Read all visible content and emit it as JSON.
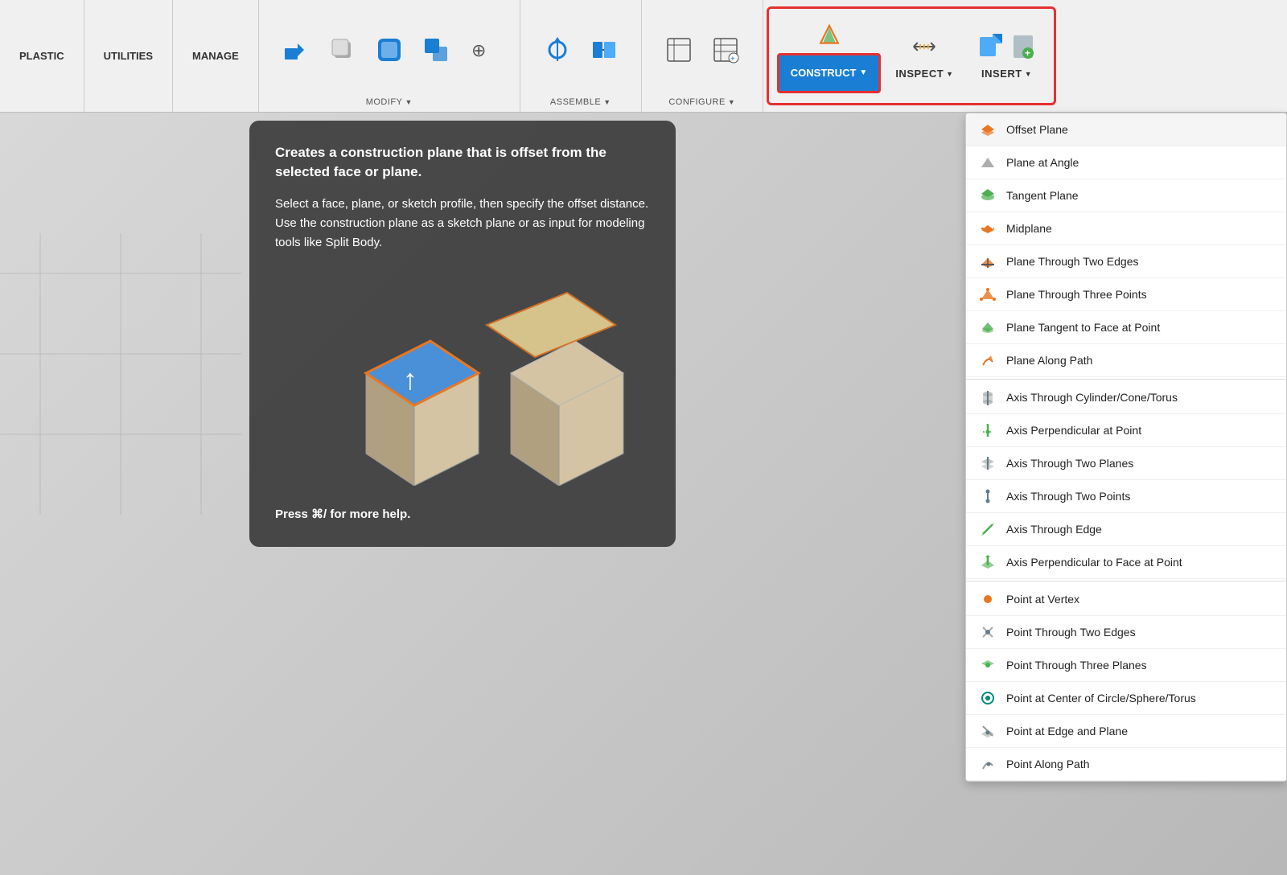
{
  "toolbar": {
    "sections": [
      {
        "label": "PLASTIC"
      },
      {
        "label": "UTILITIES"
      },
      {
        "label": "MANAGE"
      }
    ],
    "modify_label": "MODIFY",
    "assemble_label": "ASSEMBLE",
    "configure_label": "CONFIGURE",
    "construct_label": "CONSTRUCT",
    "inspect_label": "INSPECT",
    "insert_label": "INSERT"
  },
  "tooltip": {
    "title": "Creates a construction plane that is offset from the selected face or plane.",
    "body": "Select a face, plane, or sketch profile, then specify the offset distance. Use the construction plane as a sketch plane or as input for modeling tools like Split Body.",
    "footer": "Press ⌘/ for more help."
  },
  "menu": {
    "items": [
      {
        "label": "Offset Plane",
        "icon": "plane-orange",
        "active": true
      },
      {
        "label": "Plane at Angle",
        "icon": "plane-gray"
      },
      {
        "label": "Tangent Plane",
        "icon": "plane-green"
      },
      {
        "label": "Midplane",
        "icon": "plane-orange"
      },
      {
        "label": "Plane Through Two Edges",
        "icon": "plane-orange"
      },
      {
        "label": "Plane Through Three Points",
        "icon": "plane-orange"
      },
      {
        "label": "Plane Tangent to Face at Point",
        "icon": "plane-green"
      },
      {
        "label": "Plane Along Path",
        "icon": "plane-orange"
      },
      {
        "divider": true
      },
      {
        "label": "Axis Through Cylinder/Cone/Torus",
        "icon": "axis-gray"
      },
      {
        "label": "Axis Perpendicular at Point",
        "icon": "axis-green"
      },
      {
        "label": "Axis Through Two Planes",
        "icon": "axis-gray"
      },
      {
        "label": "Axis Through Two Points",
        "icon": "axis-gray"
      },
      {
        "label": "Axis Through Edge",
        "icon": "axis-green"
      },
      {
        "label": "Axis Perpendicular to Face at Point",
        "icon": "axis-green"
      },
      {
        "divider": true
      },
      {
        "label": "Point at Vertex",
        "icon": "point-orange"
      },
      {
        "label": "Point Through Two Edges",
        "icon": "point-gray"
      },
      {
        "label": "Point Through Three Planes",
        "icon": "point-green"
      },
      {
        "label": "Point at Center of Circle/Sphere/Torus",
        "icon": "point-teal"
      },
      {
        "label": "Point at Edge and Plane",
        "icon": "point-gray"
      },
      {
        "label": "Point Along Path",
        "icon": "point-gray"
      }
    ]
  }
}
